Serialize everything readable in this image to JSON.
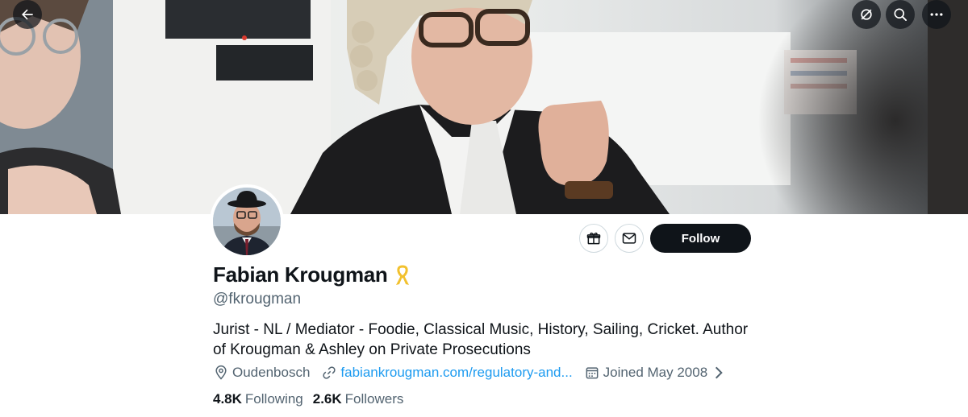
{
  "header": {
    "back_icon": "arrow-left-icon",
    "translate_icon": "grok-icon",
    "search_icon": "search-icon",
    "more_icon": "more-dots-icon"
  },
  "profile": {
    "display_name": "Fabian Krougman",
    "badge_icon": "yellow-ribbon-icon",
    "handle": "@fkrougman",
    "bio": "Jurist - NL / Mediator - Foodie, Classical Music, History, Sailing, Cricket. Author of Krougman & Ashley on Private Prosecutions",
    "location": "Oudenbosch",
    "website": "fabiankrougman.com/regulatory-and...",
    "joined": "Joined May 2008",
    "following_count": "4.8K",
    "following_label": "Following",
    "followers_count": "2.6K",
    "followers_label": "Followers"
  },
  "actions": {
    "gift_icon": "gift-icon",
    "message_icon": "envelope-icon",
    "follow_label": "Follow"
  },
  "colors": {
    "accent_link": "#1d9bf0",
    "follow_bg": "#0f1419",
    "secondary_text": "#536471",
    "ribbon": "#f2c12e"
  }
}
